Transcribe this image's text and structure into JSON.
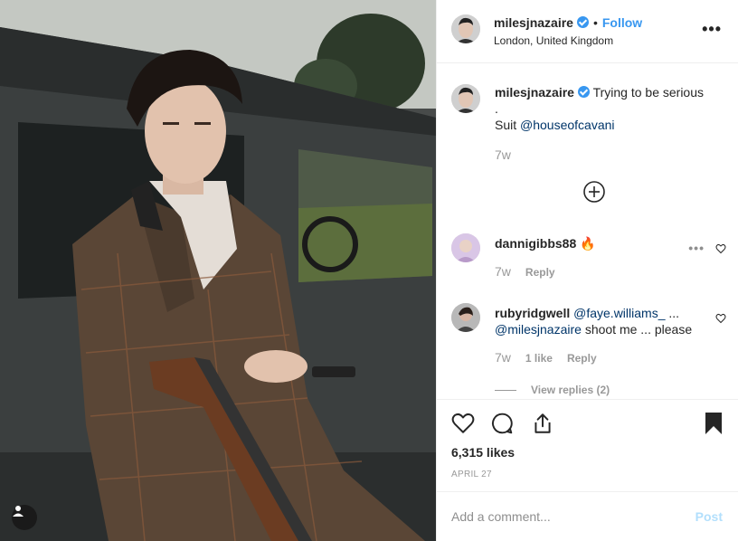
{
  "post": {
    "username": "milesjnazaire",
    "follow_label": "Follow",
    "dot": "•",
    "location": "London, United Kingdom",
    "more_label": "•••"
  },
  "caption": {
    "username": "milesjnazaire",
    "text_line1": "Trying to be serious",
    "text_line2": ".",
    "text_line3_prefix": "Suit",
    "mention": "@houseofcavani",
    "age": "7w"
  },
  "comments": [
    {
      "username": "dannigibbs88",
      "text": "🔥",
      "age": "7w",
      "reply_label": "Reply",
      "more_label": "•••"
    },
    {
      "username": "rubyridgwell",
      "mention1": "@faye.williams_",
      "ellipsis": "...",
      "mention2": "@milesjnazaire",
      "text": "shoot me ... please",
      "age": "7w",
      "likes_label": "1 like",
      "reply_label": "Reply"
    }
  ],
  "view_replies_label": "View replies (2)",
  "likes_label": "6,315 likes",
  "date_label": "APRIL 27",
  "add_comment": {
    "placeholder": "Add a comment...",
    "post_label": "Post"
  },
  "colors": {
    "accent": "#3897f0",
    "post_disabled": "#b2dffc"
  },
  "icons": {
    "verified": "verified-badge-icon",
    "heart": "heart-icon",
    "comment": "comment-icon",
    "share": "share-icon",
    "save": "bookmark-icon",
    "load_more": "plus-circle-icon",
    "user_tag": "user-tag-icon"
  }
}
